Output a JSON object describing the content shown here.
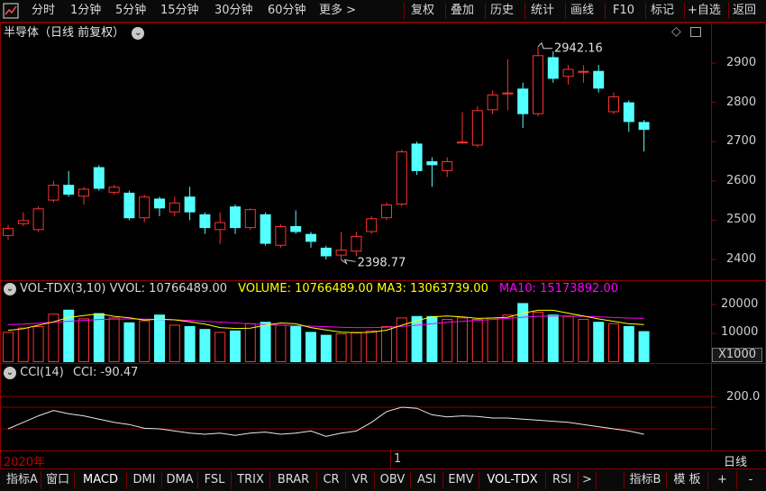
{
  "toolbar": {
    "items": [
      "分时",
      "1分钟",
      "5分钟",
      "15分钟",
      "30分钟",
      "60分钟",
      "更多 >",
      "复权",
      "叠加",
      "历史",
      "统计",
      "画线",
      "F10",
      "标记",
      "+自选",
      "返回"
    ]
  },
  "main_chart": {
    "title": "半导体（日线 前复权）",
    "high_label": "2942.16",
    "low_label": "2398.77",
    "y_axis": [
      "2900",
      "2800",
      "2700",
      "2600",
      "2500",
      "2400"
    ]
  },
  "volume": {
    "name": "VOL-TDX(3,10)",
    "vvol": "VVOL: 10766489.00",
    "volume": "VOLUME: 10766489.00",
    "ma3": "MA3: 13063739.00",
    "ma10": "MA10: 15173892.00",
    "y_axis": [
      "20000",
      "10000"
    ],
    "unit": "X1000"
  },
  "cci": {
    "name": "CCI(14)",
    "value": "CCI: -90.47",
    "y_axis": [
      "200.0"
    ]
  },
  "date_axis": {
    "start": "2020年",
    "mark": "1",
    "period": "日线"
  },
  "bottom_tabs": [
    "指标A",
    "窗口",
    "MACD",
    "DMI",
    "DMA",
    "FSL",
    "TRIX",
    "BRAR",
    "CR",
    "VR",
    "OBV",
    "ASI",
    "EMV",
    "VOL-TDX",
    "RSI",
    ">",
    "指标B",
    "模 板",
    "+",
    "-"
  ],
  "colors": {
    "up": "#ff3232",
    "down": "#54ffff",
    "ma3": "#ffff00",
    "ma10": "#ff00ff",
    "border": "#8b0000"
  },
  "chart_data": {
    "type": "candlestick",
    "candles": [
      {
        "o": 2460,
        "c": 2480,
        "h": 2488,
        "l": 2450
      },
      {
        "o": 2490,
        "c": 2500,
        "h": 2520,
        "l": 2485
      },
      {
        "o": 2475,
        "c": 2530,
        "h": 2535,
        "l": 2470
      },
      {
        "o": 2550,
        "c": 2590,
        "h": 2600,
        "l": 2545
      },
      {
        "o": 2590,
        "c": 2565,
        "h": 2625,
        "l": 2560
      },
      {
        "o": 2560,
        "c": 2580,
        "h": 2585,
        "l": 2540
      },
      {
        "o": 2635,
        "c": 2580,
        "h": 2640,
        "l": 2575
      },
      {
        "o": 2570,
        "c": 2585,
        "h": 2590,
        "l": 2565
      },
      {
        "o": 2570,
        "c": 2505,
        "h": 2575,
        "l": 2500
      },
      {
        "o": 2505,
        "c": 2560,
        "h": 2565,
        "l": 2495
      },
      {
        "o": 2555,
        "c": 2530,
        "h": 2560,
        "l": 2510
      },
      {
        "o": 2520,
        "c": 2545,
        "h": 2560,
        "l": 2510
      },
      {
        "o": 2560,
        "c": 2520,
        "h": 2585,
        "l": 2500
      },
      {
        "o": 2515,
        "c": 2480,
        "h": 2520,
        "l": 2465
      },
      {
        "o": 2475,
        "c": 2495,
        "h": 2520,
        "l": 2440
      },
      {
        "o": 2535,
        "c": 2480,
        "h": 2540,
        "l": 2465
      },
      {
        "o": 2480,
        "c": 2528,
        "h": 2530,
        "l": 2475
      },
      {
        "o": 2515,
        "c": 2440,
        "h": 2520,
        "l": 2435
      },
      {
        "o": 2435,
        "c": 2485,
        "h": 2490,
        "l": 2430
      },
      {
        "o": 2485,
        "c": 2470,
        "h": 2525,
        "l": 2465
      },
      {
        "o": 2465,
        "c": 2445,
        "h": 2470,
        "l": 2430
      },
      {
        "o": 2430,
        "c": 2408,
        "h": 2435,
        "l": 2400
      },
      {
        "o": 2410,
        "c": 2425,
        "h": 2470,
        "l": 2399
      },
      {
        "o": 2420,
        "c": 2460,
        "h": 2470,
        "l": 2408
      },
      {
        "o": 2470,
        "c": 2505,
        "h": 2510,
        "l": 2465
      },
      {
        "o": 2505,
        "c": 2540,
        "h": 2545,
        "l": 2500
      },
      {
        "o": 2540,
        "c": 2675,
        "h": 2680,
        "l": 2535
      },
      {
        "o": 2695,
        "c": 2625,
        "h": 2700,
        "l": 2615
      },
      {
        "o": 2650,
        "c": 2640,
        "h": 2660,
        "l": 2585
      },
      {
        "o": 2625,
        "c": 2650,
        "h": 2660,
        "l": 2610
      },
      {
        "o": 2700,
        "c": 2700,
        "h": 2775,
        "l": 2695
      },
      {
        "o": 2690,
        "c": 2780,
        "h": 2790,
        "l": 2685
      },
      {
        "o": 2780,
        "c": 2820,
        "h": 2830,
        "l": 2770
      },
      {
        "o": 2825,
        "c": 2825,
        "h": 2910,
        "l": 2780
      },
      {
        "o": 2835,
        "c": 2770,
        "h": 2850,
        "l": 2735
      },
      {
        "o": 2770,
        "c": 2920,
        "h": 2942,
        "l": 2765
      },
      {
        "o": 2915,
        "c": 2860,
        "h": 2930,
        "l": 2850
      },
      {
        "o": 2865,
        "c": 2885,
        "h": 2895,
        "l": 2845
      },
      {
        "o": 2880,
        "c": 2880,
        "h": 2895,
        "l": 2850
      },
      {
        "o": 2880,
        "c": 2835,
        "h": 2895,
        "l": 2825
      },
      {
        "o": 2775,
        "c": 2815,
        "h": 2825,
        "l": 2770
      },
      {
        "o": 2800,
        "c": 2750,
        "h": 2805,
        "l": 2725
      },
      {
        "o": 2750,
        "c": 2730,
        "h": 2755,
        "l": 2675
      }
    ],
    "volumes": [
      10500,
      12000,
      12500,
      16800,
      18200,
      15200,
      17000,
      15500,
      13800,
      14500,
      16500,
      13000,
      12500,
      11500,
      10500,
      11000,
      13500,
      14000,
      13000,
      12500,
      10500,
      9500,
      10000,
      10500,
      11000,
      12500,
      15500,
      16000,
      16000,
      15000,
      15500,
      15000,
      15500,
      16500,
      20500,
      17500,
      16500,
      16000,
      15000,
      14000,
      13500,
      12500,
      10766
    ],
    "ma3": [
      11000,
      11600,
      12800,
      14000,
      15500,
      16200,
      16800,
      15900,
      15400,
      14600,
      14900,
      14700,
      14000,
      13200,
      12000,
      11700,
      11800,
      12800,
      13600,
      13300,
      12000,
      11200,
      10400,
      10200,
      10400,
      11100,
      12800,
      14400,
      15700,
      16000,
      15700,
      15200,
      15300,
      15600,
      17000,
      18000,
      18000,
      17000,
      16000,
      15000,
      14200,
      13300,
      13064
    ],
    "ma10": [
      13000,
      13200,
      13500,
      13800,
      14200,
      14500,
      14800,
      14900,
      15000,
      14900,
      14800,
      14700,
      14500,
      14200,
      13900,
      13600,
      13300,
      13000,
      12800,
      12700,
      12500,
      12300,
      12100,
      12000,
      12000,
      12100,
      12400,
      12800,
      13300,
      13800,
      14200,
      14500,
      14800,
      15200,
      15600,
      15900,
      16000,
      16000,
      15900,
      15700,
      15500,
      15300,
      15174
    ],
    "cci": [
      -100,
      -40,
      20,
      70,
      40,
      20,
      -10,
      -40,
      -60,
      -95,
      -100,
      -120,
      -140,
      -150,
      -140,
      -160,
      -140,
      -130,
      -150,
      -140,
      -120,
      -170,
      -140,
      -120,
      -40,
      60,
      100,
      90,
      30,
      10,
      20,
      15,
      0,
      0,
      -10,
      -20,
      -30,
      -40,
      -60,
      -80,
      -100,
      -120,
      -150
    ]
  }
}
